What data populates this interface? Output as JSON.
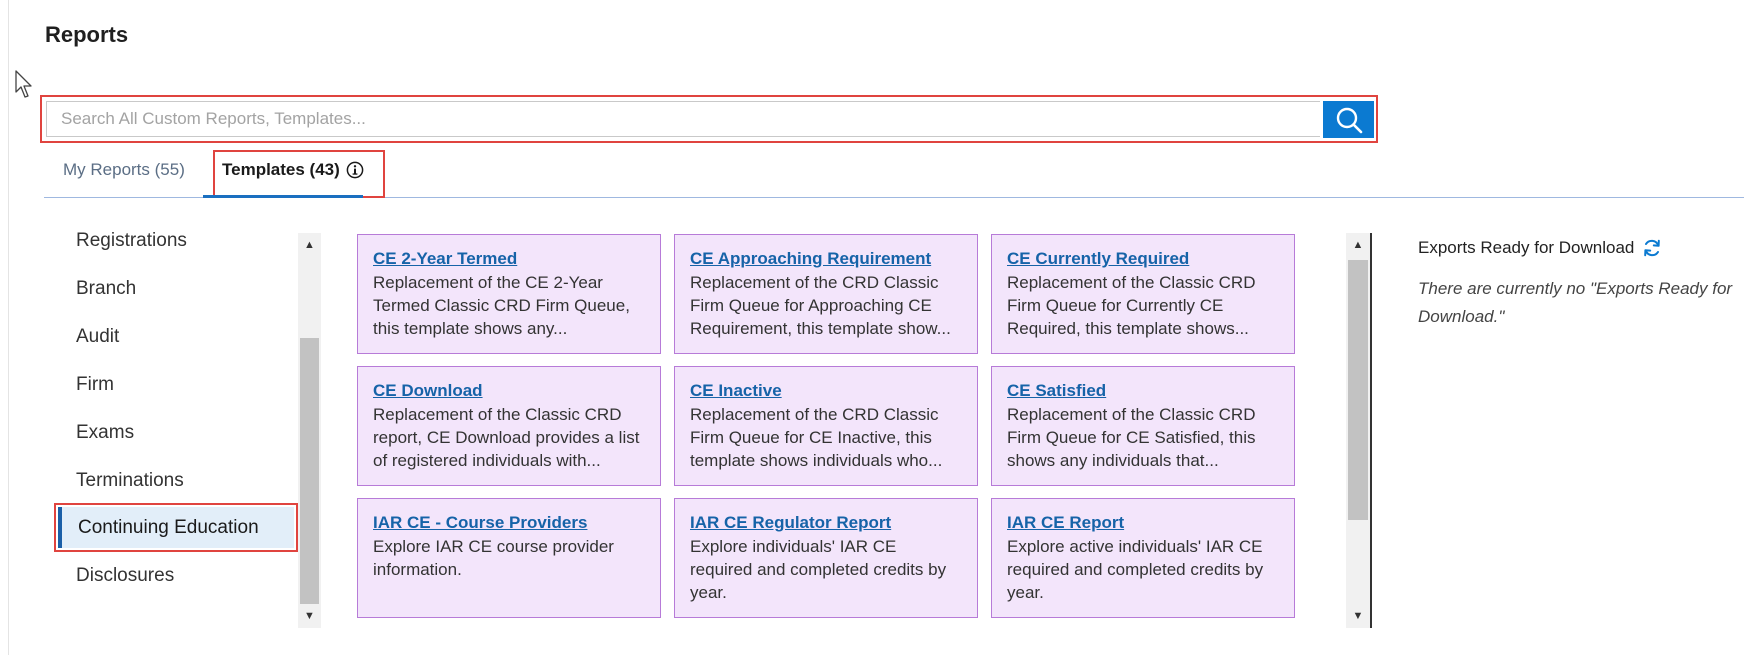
{
  "page": {
    "title": "Reports"
  },
  "search": {
    "placeholder": "Search All Custom Reports, Templates..."
  },
  "tabs": [
    {
      "label": "My Reports (55)",
      "active": false
    },
    {
      "label": "Templates (43)",
      "active": true
    }
  ],
  "categories": [
    "Registrations",
    "Branch",
    "Audit",
    "Firm",
    "Exams",
    "Terminations",
    "Continuing Education",
    "Disclosures"
  ],
  "selected_category": "Continuing Education",
  "cards": [
    {
      "title": "CE 2-Year Termed",
      "desc": "Replacement of the CE 2-Year Termed Classic CRD Firm Queue, this template shows any..."
    },
    {
      "title": "CE Approaching Requirement",
      "desc": "Replacement of the CRD Classic Firm Queue for Approaching CE Requirement, this template show..."
    },
    {
      "title": "CE Currently Required",
      "desc": "Replacement of the Classic CRD Firm Queue for Currently CE Required, this template shows..."
    },
    {
      "title": "CE Download",
      "desc": "Replacement of the Classic CRD report, CE Download provides a list of registered individuals with..."
    },
    {
      "title": "CE Inactive",
      "desc": "Replacement of the CRD Classic Firm Queue for CE Inactive, this template shows individuals who..."
    },
    {
      "title": "CE Satisfied",
      "desc": "Replacement of the Classic CRD Firm Queue for CE Satisfied, this shows any individuals that..."
    },
    {
      "title": "IAR CE - Course Providers",
      "desc": "Explore IAR CE course provider information."
    },
    {
      "title": "IAR CE Regulator Report",
      "desc": "Explore individuals' IAR CE required and completed credits by year."
    },
    {
      "title": "IAR CE Report",
      "desc": "Explore active individuals' IAR CE required and completed credits by year."
    }
  ],
  "exports": {
    "title": "Exports Ready for Download",
    "message": "There are currently no \"Exports Ready for Download.\""
  },
  "colors": {
    "accent": "#0b7ad1",
    "highlight_border": "#e0443f",
    "card_bg": "#f3e5fb",
    "card_border": "#b77bd8",
    "link": "#1663a8"
  },
  "icons": {
    "search": "search-icon",
    "info": "info-icon",
    "refresh": "refresh-icon",
    "cursor": "mouse-pointer-icon"
  }
}
